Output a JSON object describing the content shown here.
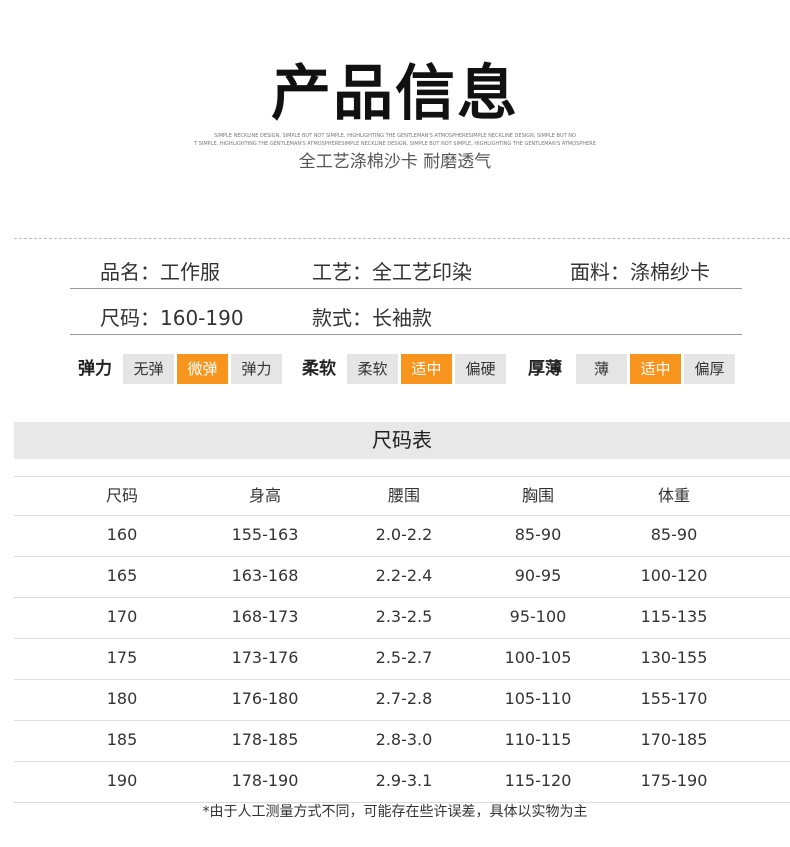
{
  "header": {
    "title": "产品信息",
    "tagline_line1": "SIMPLE NECKLINE DESIGN, SIMPLE BUT NOT SIMPLE, HIGHLIGHTING THE GENTLEMAN'S ATMOSPHERESIMPLE NECKLINE DESIGN, SIMPLE BUT NO",
    "tagline_line2": "T SIMPLE, HIGHLIGHTING THE GENTLEMAN'S ATMOSPHERESIMPLE NECKLINE DESIGN, SIMPLE BUT NOT SIMPLE, HIGHLIGHTING THE GENTLEMAN'S ATMOSPHERE",
    "subtitle": "全工艺涤棉沙卡 耐磨透气"
  },
  "info": {
    "row1": [
      "品名：工作服",
      "工艺：全工艺印染",
      "面料：涤棉纱卡"
    ],
    "row2": [
      "尺码：160-190",
      "款式：长袖款"
    ]
  },
  "attributes": [
    {
      "label": "弹力",
      "options": [
        "无弹",
        "微弹",
        "弹力"
      ],
      "selected": 1
    },
    {
      "label": "柔软",
      "options": [
        "柔软",
        "适中",
        "偏硬"
      ],
      "selected": 1
    },
    {
      "label": "厚薄",
      "options": [
        "薄",
        "适中",
        "偏厚"
      ],
      "selected": 1
    }
  ],
  "colors": {
    "accent": "#f7941d",
    "option_bg": "#e5e5e5",
    "header_bg": "#e8e8e8"
  },
  "size_table": {
    "title": "尺码表",
    "columns": [
      "尺码",
      "身高",
      "腰围",
      "胸围",
      "体重"
    ],
    "rows": [
      [
        "160",
        "155-163",
        "2.0-2.2",
        "85-90",
        "85-90"
      ],
      [
        "165",
        "163-168",
        "2.2-2.4",
        "90-95",
        "100-120"
      ],
      [
        "170",
        "168-173",
        "2.3-2.5",
        "95-100",
        "115-135"
      ],
      [
        "175",
        "173-176",
        "2.5-2.7",
        "100-105",
        "130-155"
      ],
      [
        "180",
        "176-180",
        "2.7-2.8",
        "105-110",
        "155-170"
      ],
      [
        "185",
        "178-185",
        "2.8-3.0",
        "110-115",
        "170-185"
      ],
      [
        "190",
        "178-190",
        "2.9-3.1",
        "115-120",
        "175-190"
      ]
    ]
  },
  "note": "*由于人工测量方式不同，可能存在些许误差，具体以实物为主"
}
